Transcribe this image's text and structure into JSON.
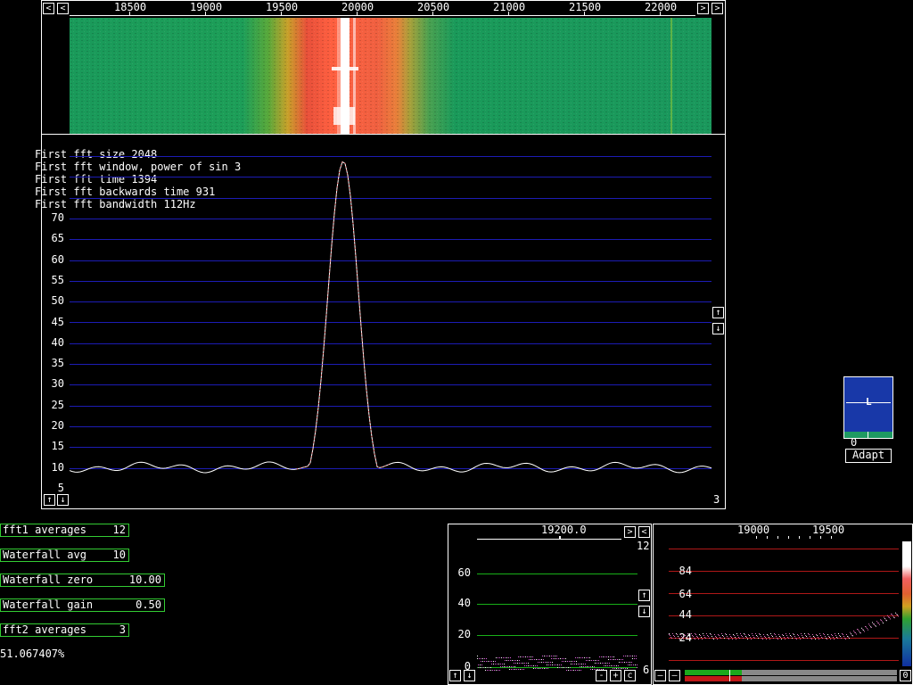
{
  "top_axis": {
    "ticks": [
      "18500",
      "19000",
      "19500",
      "20000",
      "20500",
      "21000",
      "21500",
      "22000"
    ]
  },
  "spectrum": {
    "info_lines": [
      "First fft size 2048",
      "First fft window, power of sin 3",
      "First fft time 1394",
      "First fft backwards time 931",
      "First fft bandwidth 112Hz"
    ],
    "y_ticks": [
      "70",
      "65",
      "60",
      "55",
      "50",
      "45",
      "40",
      "35",
      "30",
      "25",
      "20",
      "15",
      "10",
      "5"
    ],
    "corner_value": "3",
    "colors": {
      "grid": "#1c1cb4",
      "trace": "#ffffff",
      "peak": "#ff4040"
    }
  },
  "params": [
    {
      "label": "fft1 averages",
      "value": "12"
    },
    {
      "label": "Waterfall avg",
      "value": "10"
    },
    {
      "label": "Waterfall zero",
      "value": "10.00"
    },
    {
      "label": "Waterfall gain",
      "value": "0.50"
    },
    {
      "label": "fft2 averages",
      "value": "3"
    }
  ],
  "status_percent": "51.067407%",
  "s_meter": {
    "mode_letter": "L",
    "value": "0",
    "adapt_label": "Adapt"
  },
  "baseband": {
    "freq": "19200.0",
    "right_top": "12",
    "right_bottom": "6",
    "y_ticks": [
      "60",
      "40",
      "20",
      "0"
    ],
    "buttons": [
      "-",
      "+",
      "c"
    ]
  },
  "fft2": {
    "x_ticks": [
      "19000",
      "19500"
    ],
    "y_ticks": [
      "84",
      "64",
      "44",
      "24"
    ],
    "corner_value": "0"
  },
  "buttons": {
    "left": "<",
    "right": ">",
    "up": "↑",
    "down": "↓"
  }
}
